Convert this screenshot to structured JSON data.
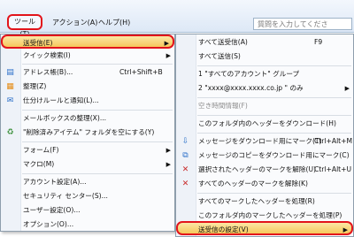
{
  "menubar": {
    "tools": "ツール(T)",
    "action": "アクション(A)",
    "help": "ヘルプ(H)",
    "search_placeholder": "質問を入力してくださ"
  },
  "main_menu": {
    "items": [
      {
        "label": "送受信(E)",
        "arrow": "▶"
      },
      {
        "label": "クイック検索(I)",
        "arrow": "▶"
      },
      {
        "label": "アドレス帳(B)...",
        "shortcut": "Ctrl+Shift+B"
      },
      {
        "label": "整理(Z)"
      },
      {
        "label": "仕分けルールと通知(L)..."
      },
      {
        "label": "メールボックスの整理(X)..."
      },
      {
        "label": "\"削除済みアイテム\" フォルダを空にする(Y)"
      },
      {
        "label": "フォーム(F)",
        "arrow": "▶"
      },
      {
        "label": "マクロ(M)",
        "arrow": "▶"
      },
      {
        "label": "アカウント設定(A)..."
      },
      {
        "label": "セキュリティ センター(S)..."
      },
      {
        "label": "ユーザー設定(O)..."
      },
      {
        "label": "オプション(O)..."
      }
    ]
  },
  "submenu": {
    "items": [
      {
        "label": "すべて送受信(A)",
        "shortcut": "F9"
      },
      {
        "label": "すべて送信(S)"
      },
      {
        "label": "1 \"すべてのアカウント\" グループ"
      },
      {
        "label": "2 \"xxxx@xxxx.xxxx.co.jp        \" のみ",
        "arrow": "▶"
      },
      {
        "label": "空き時間情報(F)"
      },
      {
        "label": "このフォルダ内のヘッダーをダウンロード(H)"
      },
      {
        "label": "メッセージをダウンロード用にマーク(T)",
        "shortcut": "Ctrl+Alt+M"
      },
      {
        "label": "メッセージのコピーをダウンロード用にマーク(C)"
      },
      {
        "label": "選択されたヘッダーのマークを解除(U)",
        "shortcut": "Ctrl+Alt+U"
      },
      {
        "label": "すべてのヘッダーのマークを解除(K)"
      },
      {
        "label": "すべてのマークしたヘッダーを処理(R)"
      },
      {
        "label": "このフォルダ内のマークしたヘッダーを処理(P)"
      },
      {
        "label": "送受信の設定(V)",
        "arrow": "▶"
      }
    ]
  }
}
